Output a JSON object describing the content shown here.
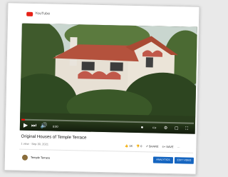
{
  "app": {
    "logo_text": "YouTube",
    "brand_color": "#e62117"
  },
  "video": {
    "title": "Original Houses of Temple Terrace",
    "meta": "1 view · Sep 30, 2021",
    "time_display": "0:00",
    "progress_fraction": 0.02
  },
  "player": {
    "play_icon": "play-icon",
    "next_icon": "next-icon",
    "volume_icon": "volume-icon",
    "settings_icon": "settings-icon",
    "fullscreen_icon": "fullscreen-icon"
  },
  "actions": {
    "like_count": "1K",
    "dislike_count": "0",
    "share_label": "SHARE",
    "save_label": "SAVE",
    "more_label": "···"
  },
  "channel": {
    "name": "Temple Terrace",
    "analytics_label": "ANALYTICS",
    "edit_label": "EDIT VIDEO"
  }
}
